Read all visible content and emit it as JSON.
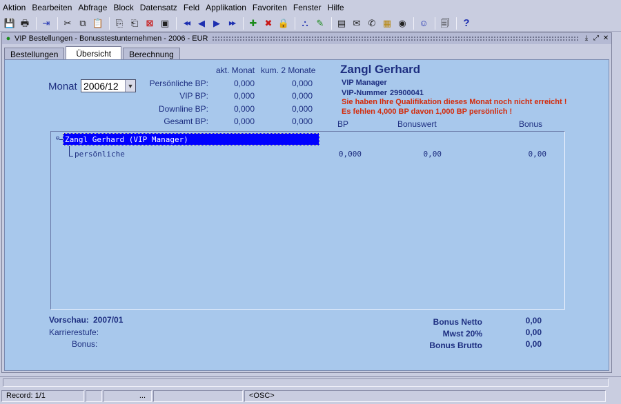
{
  "menu": [
    "Aktion",
    "Bearbeiten",
    "Abfrage",
    "Block",
    "Datensatz",
    "Feld",
    "Applikation",
    "Favoriten",
    "Fenster",
    "Hilfe"
  ],
  "toolbar": {
    "groups": [
      [
        {
          "name": "save-icon",
          "glyph": "💾",
          "cls": "blue"
        },
        {
          "name": "print-icon",
          "glyph": "🖶",
          "cls": "dark"
        }
      ],
      [
        {
          "name": "exit-icon",
          "glyph": "⇥",
          "cls": "blue"
        }
      ],
      [
        {
          "name": "cut-icon",
          "glyph": "✂",
          "cls": "dark"
        },
        {
          "name": "copy-icon",
          "glyph": "⧉",
          "cls": "dark"
        },
        {
          "name": "paste-icon",
          "glyph": "📋",
          "cls": "dark"
        }
      ],
      [
        {
          "name": "query-icon",
          "glyph": "⎘",
          "cls": "dark"
        },
        {
          "name": "execute-query-icon",
          "glyph": "⎗",
          "cls": "dark"
        },
        {
          "name": "cancel-query-icon",
          "glyph": "⊠",
          "cls": "red"
        },
        {
          "name": "count-icon",
          "glyph": "▣",
          "cls": "dark"
        }
      ],
      [
        {
          "name": "first-record-icon",
          "glyph": "◀◀",
          "cls": "blue"
        },
        {
          "name": "previous-record-icon",
          "glyph": "◀",
          "cls": "blue"
        },
        {
          "name": "next-record-icon",
          "glyph": "▶",
          "cls": "blue"
        },
        {
          "name": "last-record-icon",
          "glyph": "▶▶",
          "cls": "blue"
        }
      ],
      [
        {
          "name": "insert-record-icon",
          "glyph": "✚",
          "cls": "green"
        },
        {
          "name": "delete-record-icon",
          "glyph": "✖",
          "cls": "red"
        },
        {
          "name": "lock-record-icon",
          "glyph": "🔒",
          "cls": "gold"
        }
      ],
      [
        {
          "name": "tree-icon",
          "glyph": "⛬",
          "cls": "blue"
        },
        {
          "name": "edit-icon",
          "glyph": "✎",
          "cls": "green"
        }
      ],
      [
        {
          "name": "report-icon",
          "glyph": "▤",
          "cls": "dark"
        },
        {
          "name": "mail-icon",
          "glyph": "✉",
          "cls": "dark"
        },
        {
          "name": "phone-icon",
          "glyph": "✆",
          "cls": "dark"
        },
        {
          "name": "calendar-icon",
          "glyph": "▦",
          "cls": "gold"
        },
        {
          "name": "preview-icon",
          "glyph": "◉",
          "cls": "dark"
        }
      ],
      [
        {
          "name": "user-icon",
          "glyph": "☺",
          "cls": "blue"
        }
      ],
      [
        {
          "name": "documents-icon",
          "glyph": "🗐",
          "cls": "dark"
        }
      ],
      [
        {
          "name": "help-icon",
          "glyph": "?",
          "cls": "help"
        }
      ]
    ]
  },
  "window": {
    "title": "VIP Bestellungen - Bonusstestunternehmen - 2006 - EUR",
    "minimize": "⤓",
    "restore": "⤢",
    "close": "✕"
  },
  "tabs": [
    "Bestellungen",
    "Übersicht",
    "Berechnung"
  ],
  "overview": {
    "month_label": "Monat",
    "month_value": "2006/12",
    "col_current": "akt. Monat",
    "col_cumulative": "kum. 2 Monate",
    "rows": [
      {
        "label": "Persönliche BP:",
        "current": "0,000",
        "cumulative": "0,000"
      },
      {
        "label": "VIP BP:",
        "current": "0,000",
        "cumulative": "0,000"
      },
      {
        "label": "Downline BP:",
        "current": "0,000",
        "cumulative": "0,000"
      },
      {
        "label": "Gesamt BP:",
        "current": "0,000",
        "cumulative": "0,000"
      }
    ],
    "name": "Zangl Gerhard",
    "rank": "VIP Manager",
    "vip_number_label": "VIP-Nummer",
    "vip_number": "29900041",
    "warning1": "Sie haben Ihre Qualifikation dieses Monat noch nicht erreicht !",
    "warning2": "Es fehlen 4,000 BP davon 1,000 BP persönlich !",
    "tree_col_bp": "BP",
    "tree_col_bonuswert": "Bonuswert",
    "tree_col_bonus": "Bonus",
    "tree_root": "Zangl Gerhard (VIP Manager)",
    "tree_child": "persönliche",
    "tree_child_bp": "0,000",
    "tree_child_bonuswert": "0,00",
    "tree_child_bonus": "0,00",
    "preview_label": "Vorschau:",
    "preview_value": "2007/01",
    "career_label": "Karrierestufe:",
    "bonus_label": "Bonus:",
    "bonus_netto_label": "Bonus Netto",
    "bonus_netto": "0,00",
    "mwst_label": "Mwst 20%",
    "mwst": "0,00",
    "bonus_brutto_label": "Bonus Brutto",
    "bonus_brutto": "0,00"
  },
  "status": {
    "record": "Record: 1/1",
    "ellipsis": "...",
    "osc": "<OSC>"
  }
}
